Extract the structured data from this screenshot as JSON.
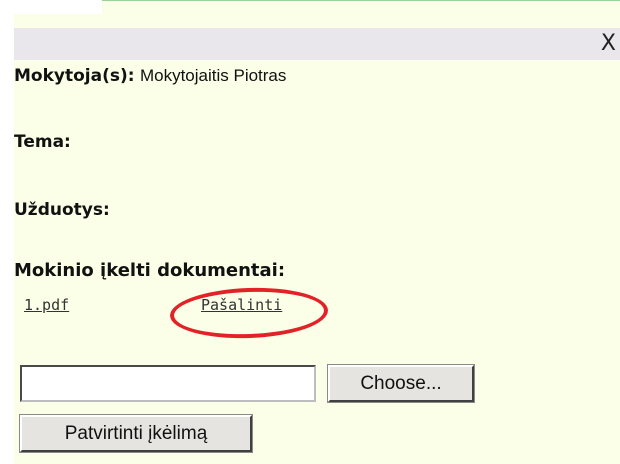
{
  "dialog": {
    "close_glyph": "X",
    "teacher_label": "Mokytoja(s):",
    "teacher_value": "Mokytojaitis Piotras",
    "topic_label": "Tema:",
    "tasks_label": "Užduotys:",
    "documents_heading": "Mokinio įkelti dokumentai:",
    "document_file": "1.pdf",
    "remove_link": "Pašalinti",
    "file_input_value": "",
    "choose_button": "Choose...",
    "confirm_upload_button": "Patvirtinti įkėlimą"
  },
  "colors": {
    "panel_background": "#fbffe8",
    "titlebar_background": "#e9e7ec",
    "annotation_ellipse": "#e32227",
    "button_face": "#e6e4e0"
  }
}
